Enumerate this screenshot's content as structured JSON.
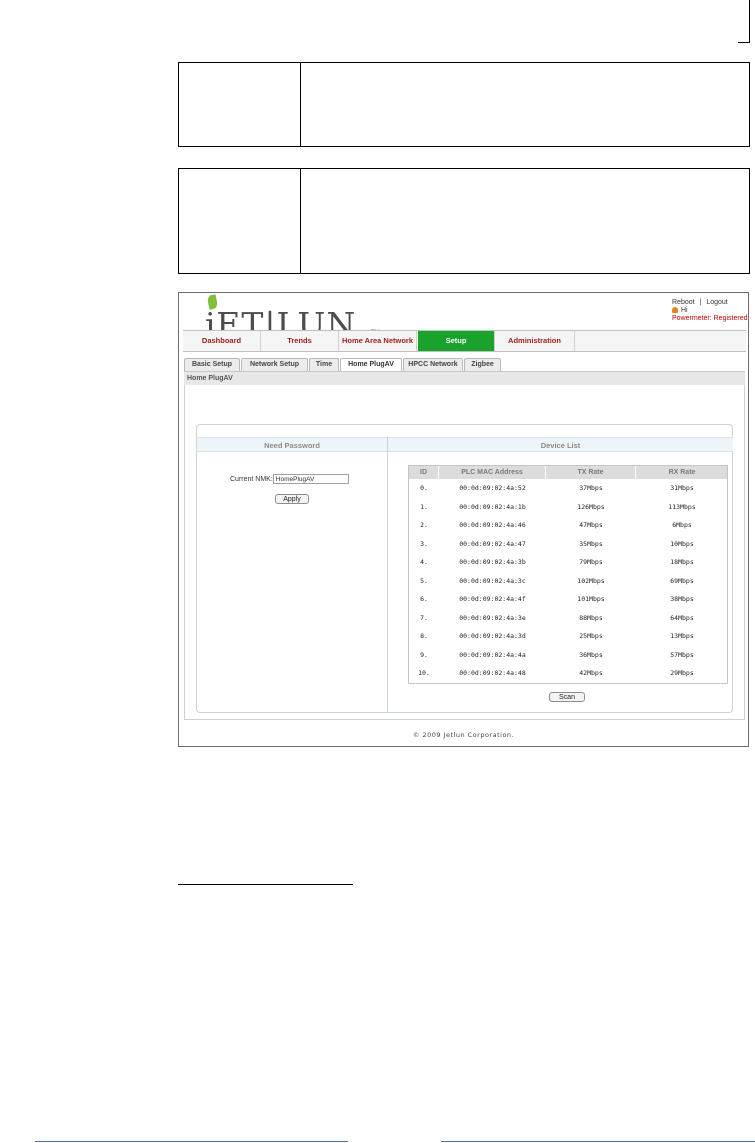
{
  "brand": {
    "logo_text": "jET|LUN",
    "tm": "TM"
  },
  "top_links": {
    "reboot": "Reboot",
    "separator": "|",
    "logout": "Logout",
    "greeting": "Hi",
    "powermeter": "Powermeter: Registered"
  },
  "nav": {
    "items": [
      "Dashboard",
      "Trends",
      "Home Area Network",
      "Setup",
      "Administration"
    ],
    "active": "Setup",
    "active_color": "#1aa32a",
    "label_color": "#9b1c1c"
  },
  "subtabs": {
    "items": [
      "Basic Setup",
      "Network Setup",
      "Time",
      "Home PlugAV",
      "HPCC Network",
      "Zigbee"
    ],
    "active": "Home PlugAV"
  },
  "section_title": "Home PlugAV",
  "password_panel": {
    "title": "Need Password",
    "nmk_label": "Current NMK:",
    "nmk_value": "HomePlugAV",
    "apply_label": "Apply"
  },
  "device_list": {
    "title": "Device List",
    "columns": [
      "ID",
      "PLC MAC Address",
      "TX Rate",
      "RX Rate"
    ],
    "rows": [
      [
        "0.",
        "00:0d:09:02:4a:52",
        "37Mbps",
        "31Mbps"
      ],
      [
        "1.",
        "00:0d:09:02:4a:1b",
        "126Mbps",
        "113Mbps"
      ],
      [
        "2.",
        "00:0d:09:02:4a:46",
        "47Mbps",
        "6Mbps"
      ],
      [
        "3.",
        "00:0d:09:02:4a:47",
        "35Mbps",
        "10Mbps"
      ],
      [
        "4.",
        "00:0d:09:02:4a:3b",
        "79Mbps",
        "18Mbps"
      ],
      [
        "5.",
        "00:0d:09:02:4a:3c",
        "102Mbps",
        "69Mbps"
      ],
      [
        "6.",
        "00:0d:09:02:4a:4f",
        "101Mbps",
        "38Mbps"
      ],
      [
        "7.",
        "00:0d:09:02:4a:3e",
        "88Mbps",
        "64Mbps"
      ],
      [
        "8.",
        "00:0d:09:02:4a:3d",
        "25Mbps",
        "13Mbps"
      ],
      [
        "9.",
        "00:0d:09:02:4a:4a",
        "36Mbps",
        "57Mbps"
      ],
      [
        "10.",
        "00:0d:09:02:4a:48",
        "42Mbps",
        "29Mbps"
      ]
    ],
    "scan_label": "Scan"
  },
  "footer": "© 2009 Jetlun Corporation."
}
